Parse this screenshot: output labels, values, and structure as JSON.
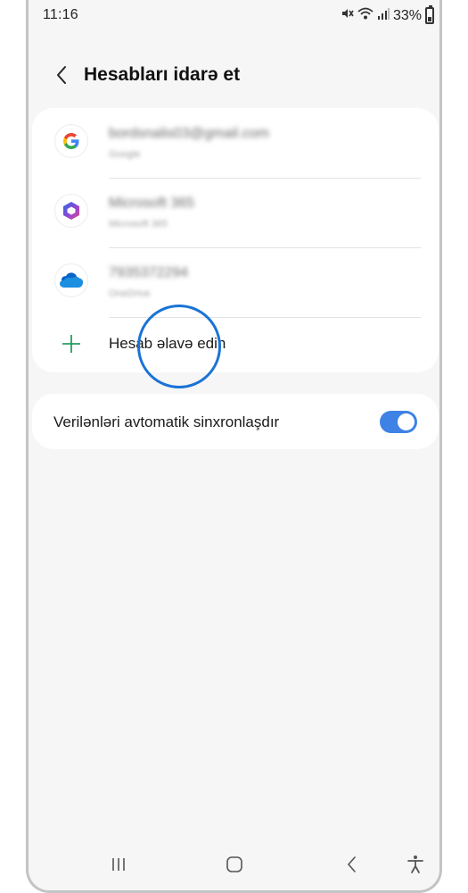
{
  "status_bar": {
    "time": "11:16",
    "battery": "33%"
  },
  "header": {
    "title": "Hesabları idarə et"
  },
  "accounts": [
    {
      "name": "bordsnalis03@gmail.com",
      "type": "Google",
      "icon": "google-icon"
    },
    {
      "name": "Microsoft 365",
      "type": "Microsoft 365",
      "icon": "microsoft-365-icon"
    },
    {
      "name": "7935372294",
      "type": "OneDrive",
      "icon": "onedrive-icon"
    }
  ],
  "add_account": {
    "label": "Hesab əlavə edin"
  },
  "sync": {
    "label": "Verilənləri avtomatik sinxronlaşdır",
    "enabled": true
  },
  "colors": {
    "accent": "#3e82e6",
    "highlight": "#1a73d6",
    "plus": "#2a9b63",
    "background": "#f6f6f6"
  }
}
